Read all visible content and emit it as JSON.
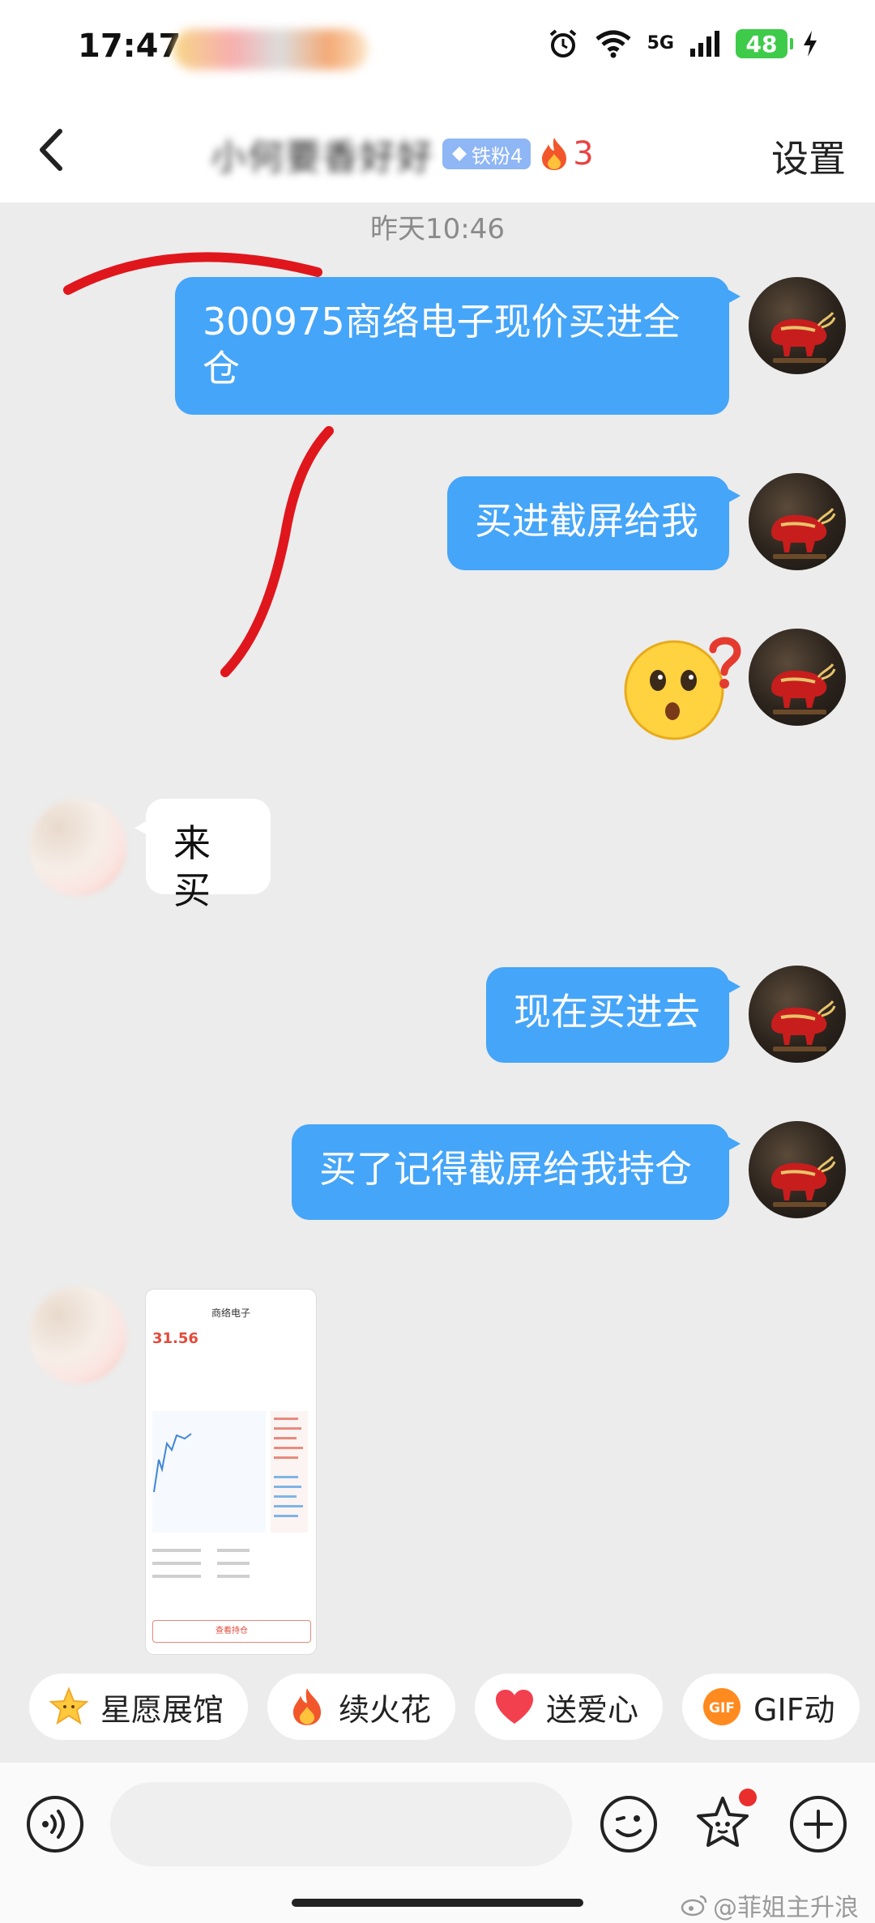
{
  "status_bar": {
    "time": "17:47",
    "network": "5G",
    "battery": "48"
  },
  "header": {
    "title": "小何要香好好",
    "fan_badge": "铁粉4",
    "fire_count": "3",
    "settings": "设置"
  },
  "chat": {
    "timestamp": "昨天10:46",
    "messages": [
      {
        "side": "me",
        "text": "300975商络电子现价买进全仓"
      },
      {
        "side": "me",
        "text": "买进截屏给我"
      },
      {
        "side": "me",
        "text": "",
        "emoji": "confused-face-question"
      },
      {
        "side": "them",
        "text": "来买"
      },
      {
        "side": "me",
        "text": "现在买进去"
      },
      {
        "side": "me",
        "text": "买了记得截屏给我持仓"
      },
      {
        "side": "them",
        "text": "",
        "image": "stock-app-screenshot"
      }
    ],
    "thumbnail": {
      "title": "商络电子",
      "price": "31.56",
      "button": "查看持仓"
    }
  },
  "quick_actions": [
    {
      "label": "星愿展馆",
      "icon": "star-icon"
    },
    {
      "label": "续火花",
      "icon": "fire-icon"
    },
    {
      "label": "送爱心",
      "icon": "heart-icon"
    },
    {
      "label": "GIF动",
      "icon": "gif-icon"
    }
  ],
  "input": {
    "placeholder": ""
  },
  "watermark": "@菲姐主升浪",
  "colors": {
    "my_bubble": "#45a5f8",
    "their_bubble": "#ffffff",
    "background": "#ececec",
    "annotation": "#e0161d"
  }
}
